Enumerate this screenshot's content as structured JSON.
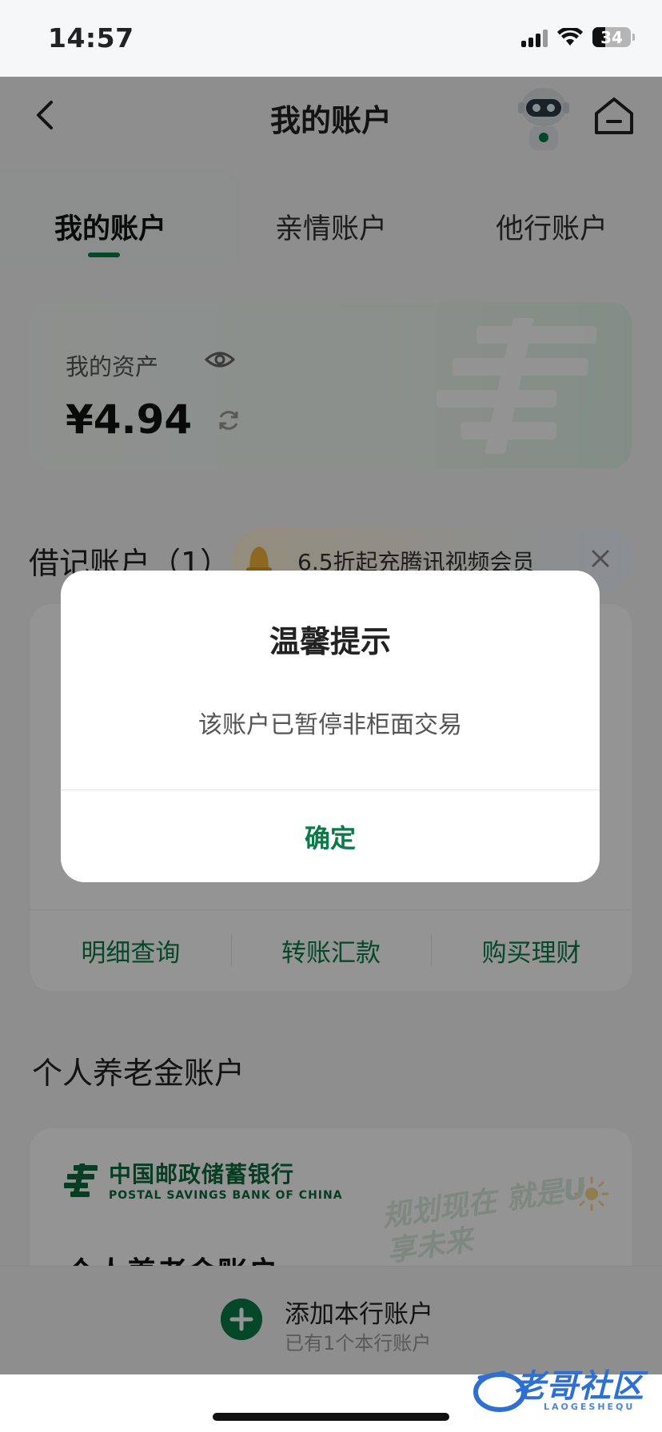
{
  "status_bar": {
    "time": "14:57",
    "battery": "34",
    "battery_level": 0.34
  },
  "nav": {
    "title": "我的账户"
  },
  "tabs": [
    {
      "label": "我的账户",
      "active": true
    },
    {
      "label": "亲情账户",
      "active": false
    },
    {
      "label": "他行账户",
      "active": false
    }
  ],
  "assets": {
    "label": "我的资产",
    "amount": "¥4.94"
  },
  "debit": {
    "title": "借记账户（1）",
    "promo_text": "6.5折起充腾讯视频会员",
    "actions": [
      "明细查询",
      "转账汇款",
      "购买理财"
    ]
  },
  "pension": {
    "title": "个人养老金账户",
    "bank_name_cn": "中国邮政储蓄银行",
    "bank_name_en": "POSTAL SAVINGS BANK OF CHINA",
    "slogan": "规划现在 就是U享未来",
    "partial_heading": "个人养老金账户"
  },
  "bottom": {
    "add_label": "添加本行账户",
    "add_sub": "已有1个本行账户"
  },
  "watermark": {
    "text": "老哥社区",
    "sub": "LAOGESHEQU"
  },
  "dialog": {
    "title": "温馨提示",
    "message": "该账户已暂停非柜面交易",
    "confirm": "确定"
  },
  "colors": {
    "brand_green": "#0a7a48",
    "overlay": "rgba(0,0,0,0.42)"
  }
}
